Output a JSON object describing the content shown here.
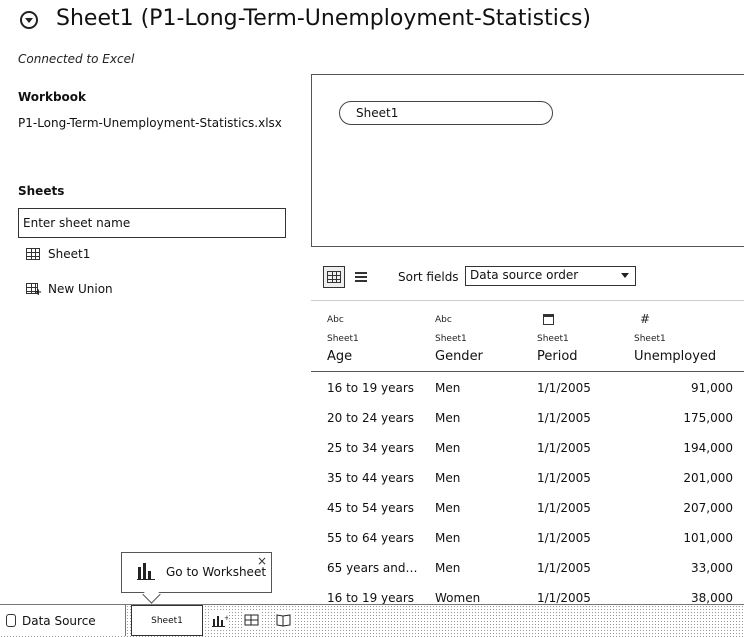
{
  "header": {
    "title": "Sheet1 (P1-Long-Term-Unemployment-Statistics)",
    "connection_status": "Connected to Excel"
  },
  "left_pane": {
    "workbook_label": "Workbook",
    "workbook_file": "P1-Long-Term-Unemployment-Statistics.xlsx",
    "sheets_label": "Sheets",
    "sheet_search_placeholder": "Enter sheet name",
    "items": [
      {
        "label": "Sheet1",
        "icon": "sheet-grid-icon"
      },
      {
        "label": "New Union",
        "icon": "new-union-icon"
      }
    ]
  },
  "canvas": {
    "tables": [
      {
        "label": "Sheet1"
      }
    ]
  },
  "grid_toolbar": {
    "sort_label": "Sort fields",
    "sort_value": "Data source order"
  },
  "grid": {
    "columns": [
      {
        "type_icon": "Abc",
        "source": "Sheet1",
        "name": "Age"
      },
      {
        "type_icon": "Abc",
        "source": "Sheet1",
        "name": "Gender"
      },
      {
        "type_icon": "calendar-icon",
        "source": "Sheet1",
        "name": "Period"
      },
      {
        "type_icon": "#",
        "source": "Sheet1",
        "name": "Unemployed"
      }
    ],
    "rows": [
      [
        "16 to 19 years",
        "Men",
        "1/1/2005",
        "91,000"
      ],
      [
        "20 to 24 years",
        "Men",
        "1/1/2005",
        "175,000"
      ],
      [
        "25 to 34 years",
        "Men",
        "1/1/2005",
        "194,000"
      ],
      [
        "35 to 44 years",
        "Men",
        "1/1/2005",
        "201,000"
      ],
      [
        "45 to 54 years",
        "Men",
        "1/1/2005",
        "207,000"
      ],
      [
        "55 to 64 years",
        "Men",
        "1/1/2005",
        "101,000"
      ],
      [
        "65 years and o...",
        "Men",
        "1/1/2005",
        "33,000"
      ],
      [
        "16 to 19 years",
        "Women",
        "1/1/2005",
        "38,000"
      ]
    ]
  },
  "bottom_tabs": {
    "data_source_label": "Data Source",
    "sheet_tab_label": "Sheet1"
  },
  "tooltip": {
    "text": "Go to Worksheet",
    "close_glyph": "×"
  }
}
